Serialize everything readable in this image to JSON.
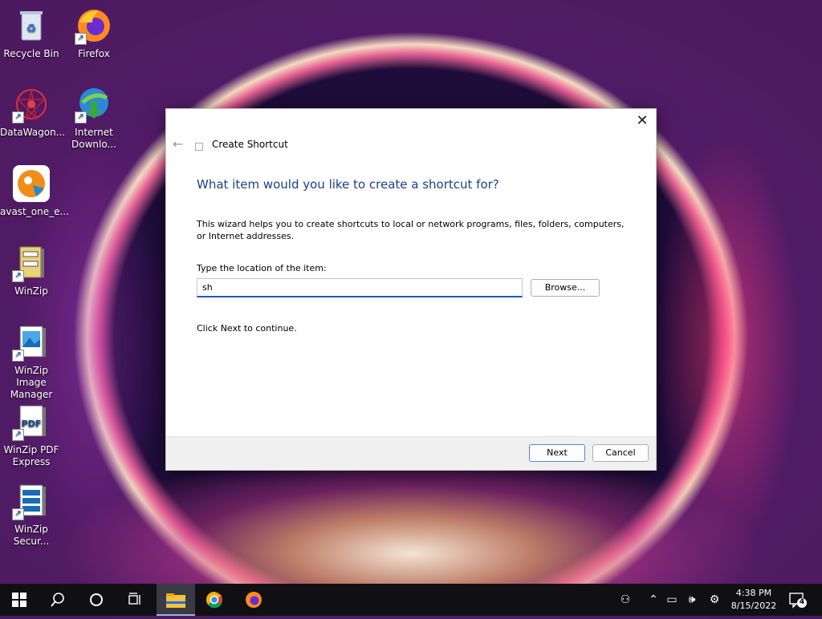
{
  "desktop": {
    "icons": [
      {
        "label": "Recycle Bin",
        "icon": "recycle-bin-icon"
      },
      {
        "label": "Firefox",
        "icon": "firefox-icon"
      },
      {
        "label": "DataWagon...",
        "icon": "datawagon-icon"
      },
      {
        "label": "Internet Downlo...",
        "icon": "internet-download-manager-icon"
      },
      {
        "label": "avast_one_e...",
        "icon": "avast-icon"
      },
      {
        "label": "WinZip",
        "icon": "winzip-icon"
      },
      {
        "label": "WinZip Image Manager",
        "icon": "winzip-image-manager-icon"
      },
      {
        "label": "WinZip PDF Express",
        "icon": "winzip-pdf-icon"
      },
      {
        "label": "WinZip Secur...",
        "icon": "winzip-secure-icon"
      }
    ]
  },
  "dialog": {
    "title": "Create Shortcut",
    "heading": "What item would you like to create a shortcut for?",
    "description": "This wizard helps you to create shortcuts to local or network programs, files, folders, computers, or Internet addresses.",
    "location_label": "Type the location of the item:",
    "location_value": "sh",
    "browse_label": "Browse...",
    "hint": "Click Next to continue.",
    "next_label": "Next",
    "cancel_label": "Cancel",
    "close_glyph": "✕",
    "back_glyph": "←"
  },
  "taskbar": {
    "time": "4:38 PM",
    "date": "8/15/2022",
    "notification_count": "4"
  },
  "colors": {
    "accent": "#1a5fb4",
    "heading": "#1b3f8b",
    "taskbar": "#101014"
  }
}
